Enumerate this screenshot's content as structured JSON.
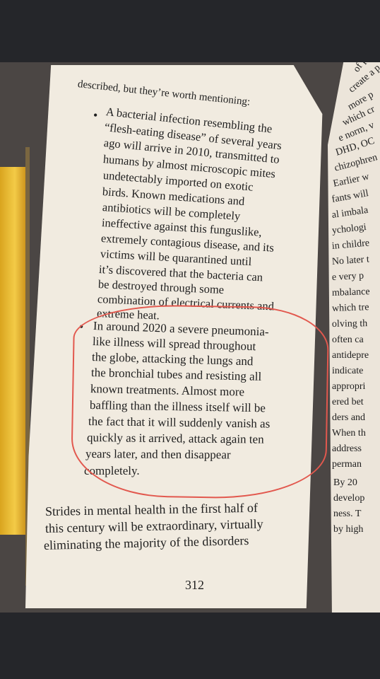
{
  "book_page": {
    "header": "described, but they’re worth mentioning:",
    "bullet_symbol": "•",
    "item1": [
      "A bacterial infection resembling the",
      "“flesh-eating disease” of several years",
      "ago will arrive in 2010, transmitted to",
      "humans by almost microscopic mites",
      "undetectably imported on exotic",
      "birds. Known medications and",
      "antibiotics will be completely",
      "ineffective against this funguslike,",
      "extremely contagious disease, and its",
      "victims will be quarantined until",
      "it’s discovered that the bacteria can",
      "be destroyed through some",
      "combination of electrical currents and",
      "extreme heat."
    ],
    "item2": [
      "In around 2020 a severe pneumonia-",
      "like illness will spread throughout",
      "the globe, attacking the lungs and",
      "the bronchial tubes and resisting all",
      "known treatments. Almost more",
      "baffling than the illness itself will be",
      "the fact that it will suddenly vanish as",
      "quickly as it arrived, attack again ten",
      "years later, and then disappear",
      "completely."
    ],
    "paragraph": [
      "Strides in mental health in the first half of",
      "this century will be extraordinary, virtually",
      "eliminating the majority of the disorders"
    ],
    "page_number": "312"
  },
  "right_page_fragments": [
    "of plague",
    "create a p",
    "more p",
    "which cr",
    "e norm, v",
    "DHD, OC",
    "chizophren",
    "Earlier w",
    "fants will",
    "al imbala",
    "ychologi",
    "in childre",
    "No later t",
    "e very p",
    "mbalance",
    "which tre",
    "olving th",
    "often ca",
    "antidepre",
    "indicate",
    "appropri",
    "ered bet",
    "ders and",
    "When th",
    "address",
    "perman",
    "By 20",
    "develop",
    "ness. T",
    "by high"
  ],
  "colors": {
    "page": "#f1ebe0",
    "ink": "#1f1f1f",
    "highlight_circle": "#e2584e",
    "background": "#25262a"
  }
}
